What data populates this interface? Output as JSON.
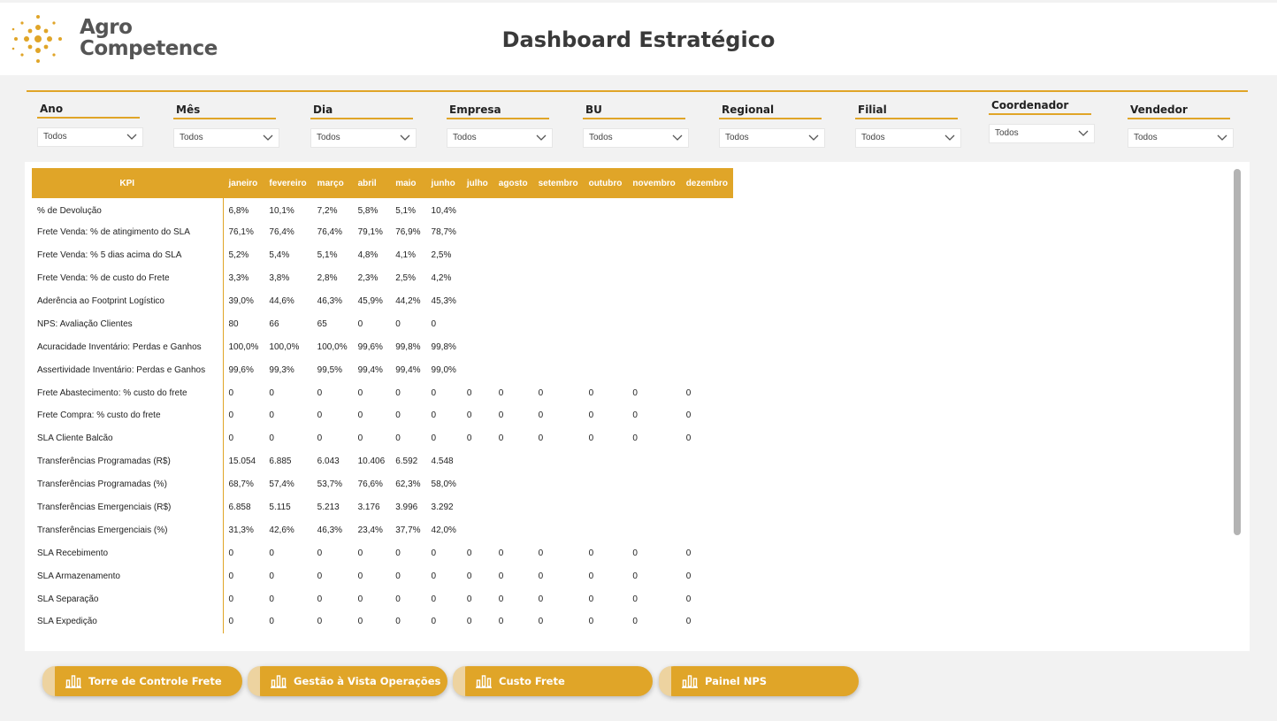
{
  "brand": {
    "line1": "Agro",
    "line2": "Competence",
    "accent_color": "#e0a528"
  },
  "page_title": "Dashboard Estratégico",
  "filters": [
    {
      "label": "Ano",
      "value": "Todos"
    },
    {
      "label": "Mês",
      "value": "Todos"
    },
    {
      "label": "Dia",
      "value": "Todos"
    },
    {
      "label": "Empresa",
      "value": "Todos"
    },
    {
      "label": "BU",
      "value": "Todos"
    },
    {
      "label": "Regional",
      "value": "Todos"
    },
    {
      "label": "Filial",
      "value": "Todos"
    },
    {
      "label": "Coordenador",
      "value": "Todos"
    },
    {
      "label": "Vendedor",
      "value": "Todos"
    }
  ],
  "table": {
    "header_kpi": "KPI",
    "months": [
      "janeiro",
      "fevereiro",
      "março",
      "abril",
      "maio",
      "junho",
      "julho",
      "agosto",
      "setembro",
      "outubro",
      "novembro",
      "dezembro"
    ],
    "rows": [
      {
        "kpi": "% de Devolução",
        "values": [
          "6,8%",
          "10,1%",
          "7,2%",
          "5,8%",
          "5,1%",
          "10,4%",
          "",
          "",
          "",
          "",
          "",
          ""
        ]
      },
      {
        "kpi": "Frete Venda: % de atingimento do SLA",
        "values": [
          "76,1%",
          "76,4%",
          "76,4%",
          "79,1%",
          "76,9%",
          "78,7%",
          "",
          "",
          "",
          "",
          "",
          ""
        ]
      },
      {
        "kpi": "Frete Venda: % 5 dias acima do SLA",
        "values": [
          "5,2%",
          "5,4%",
          "5,1%",
          "4,8%",
          "4,1%",
          "2,5%",
          "",
          "",
          "",
          "",
          "",
          ""
        ]
      },
      {
        "kpi": "Frete Venda: % de custo do Frete",
        "values": [
          "3,3%",
          "3,8%",
          "2,8%",
          "2,3%",
          "2,5%",
          "4,2%",
          "",
          "",
          "",
          "",
          "",
          ""
        ]
      },
      {
        "kpi": "Aderência ao Footprint Logístico",
        "values": [
          "39,0%",
          "44,6%",
          "46,3%",
          "45,9%",
          "44,2%",
          "45,3%",
          "",
          "",
          "",
          "",
          "",
          ""
        ]
      },
      {
        "kpi": "NPS: Avaliação Clientes",
        "values": [
          "80",
          "66",
          "65",
          "0",
          "0",
          "0",
          "",
          "",
          "",
          "",
          "",
          ""
        ]
      },
      {
        "kpi": "Acuracidade Inventário: Perdas e Ganhos",
        "values": [
          "100,0%",
          "100,0%",
          "100,0%",
          "99,6%",
          "99,8%",
          "99,8%",
          "",
          "",
          "",
          "",
          "",
          ""
        ]
      },
      {
        "kpi": "Assertividade Inventário: Perdas e Ganhos",
        "values": [
          "99,6%",
          "99,3%",
          "99,5%",
          "99,4%",
          "99,4%",
          "99,0%",
          "",
          "",
          "",
          "",
          "",
          ""
        ]
      },
      {
        "kpi": "Frete Abastecimento: % custo do frete",
        "values": [
          "0",
          "0",
          "0",
          "0",
          "0",
          "0",
          "0",
          "0",
          "0",
          "0",
          "0",
          "0"
        ]
      },
      {
        "kpi": "Frete Compra: % custo do frete",
        "values": [
          "0",
          "0",
          "0",
          "0",
          "0",
          "0",
          "0",
          "0",
          "0",
          "0",
          "0",
          "0"
        ]
      },
      {
        "kpi": "SLA Cliente Balcão",
        "values": [
          "0",
          "0",
          "0",
          "0",
          "0",
          "0",
          "0",
          "0",
          "0",
          "0",
          "0",
          "0"
        ]
      },
      {
        "kpi": "Transferências Programadas (R$)",
        "values": [
          "15.054",
          "6.885",
          "6.043",
          "10.406",
          "6.592",
          "4.548",
          "",
          "",
          "",
          "",
          "",
          ""
        ]
      },
      {
        "kpi": "Transferências Programadas (%)",
        "values": [
          "68,7%",
          "57,4%",
          "53,7%",
          "76,6%",
          "62,3%",
          "58,0%",
          "",
          "",
          "",
          "",
          "",
          ""
        ]
      },
      {
        "kpi": "Transferências Emergenciais (R$)",
        "values": [
          "6.858",
          "5.115",
          "5.213",
          "3.176",
          "3.996",
          "3.292",
          "",
          "",
          "",
          "",
          "",
          ""
        ]
      },
      {
        "kpi": "Transferências Emergenciais (%)",
        "values": [
          "31,3%",
          "42,6%",
          "46,3%",
          "23,4%",
          "37,7%",
          "42,0%",
          "",
          "",
          "",
          "",
          "",
          ""
        ]
      },
      {
        "kpi": "SLA Recebimento",
        "values": [
          "0",
          "0",
          "0",
          "0",
          "0",
          "0",
          "0",
          "0",
          "0",
          "0",
          "0",
          "0"
        ]
      },
      {
        "kpi": "SLA Armazenamento",
        "values": [
          "0",
          "0",
          "0",
          "0",
          "0",
          "0",
          "0",
          "0",
          "0",
          "0",
          "0",
          "0"
        ]
      },
      {
        "kpi": "SLA Separação",
        "values": [
          "0",
          "0",
          "0",
          "0",
          "0",
          "0",
          "0",
          "0",
          "0",
          "0",
          "0",
          "0"
        ]
      },
      {
        "kpi": "SLA Expedição",
        "values": [
          "0",
          "0",
          "0",
          "0",
          "0",
          "0",
          "0",
          "0",
          "0",
          "0",
          "0",
          "0"
        ]
      }
    ]
  },
  "nav_buttons": [
    {
      "label": "Torre de Controle Frete",
      "icon": "bar-chart-icon"
    },
    {
      "label": "Gestão à Vista Operações",
      "icon": "bar-chart-icon"
    },
    {
      "label": "Custo Frete",
      "icon": "bar-chart-icon"
    },
    {
      "label": "Painel NPS",
      "icon": "bar-chart-icon"
    }
  ]
}
